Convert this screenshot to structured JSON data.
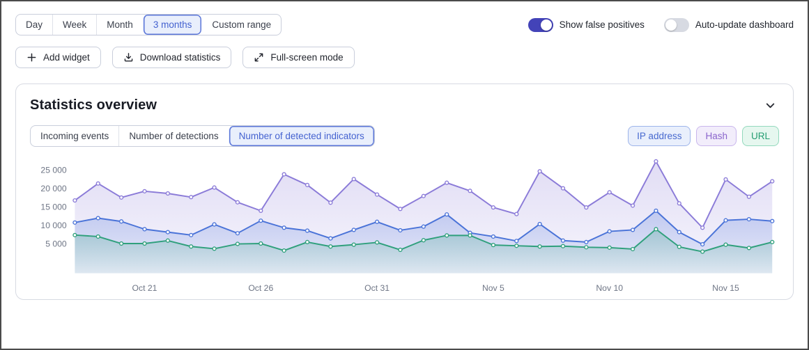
{
  "toolbar": {
    "range_tabs": [
      {
        "label": "Day",
        "active": false
      },
      {
        "label": "Week",
        "active": false
      },
      {
        "label": "Month",
        "active": false
      },
      {
        "label": "3 months",
        "active": true
      },
      {
        "label": "Custom range",
        "active": false
      }
    ],
    "toggles": [
      {
        "label": "Show false positives",
        "on": true
      },
      {
        "label": "Auto-update dashboard",
        "on": false
      }
    ],
    "toggle_on_color": "#4343b8",
    "toggle_off_color": "#d7dae2",
    "actions": [
      {
        "label": "Add widget",
        "icon": "plus-icon"
      },
      {
        "label": "Download statistics",
        "icon": "download-icon"
      },
      {
        "label": "Full-screen mode",
        "icon": "fullscreen-icon"
      }
    ]
  },
  "card": {
    "title": "Statistics overview",
    "accent_color": "#4462d0",
    "tabs": [
      {
        "label": "Incoming events",
        "active": false
      },
      {
        "label": "Number of detections",
        "active": false
      },
      {
        "label": "Number of detected indicators",
        "active": true
      }
    ],
    "badges": [
      {
        "label": "IP address",
        "text_color": "#4769cf",
        "bg": "#e9effc",
        "border": "#9db4ea"
      },
      {
        "label": "Hash",
        "text_color": "#8a64cc",
        "bg": "#f2edfb",
        "border": "#c9b6ec"
      },
      {
        "label": "URL",
        "text_color": "#259d72",
        "bg": "#e6f7ef",
        "border": "#93d9bd"
      }
    ]
  },
  "chart_data": {
    "type": "line",
    "title": "Statistics overview",
    "xlabel": "",
    "ylabel": "",
    "grid": false,
    "legend_position": "top-right chips",
    "legend": [
      "IP address",
      "Hash",
      "URL"
    ],
    "ylim": [
      0,
      28000
    ],
    "yticks": [
      5000,
      10000,
      15000,
      20000,
      25000
    ],
    "x": [
      "Oct 18",
      "Oct 19",
      "Oct 20",
      "Oct 21",
      "Oct 22",
      "Oct 23",
      "Oct 24",
      "Oct 25",
      "Oct 26",
      "Oct 27",
      "Oct 28",
      "Oct 29",
      "Oct 30",
      "Oct 31",
      "Nov 1",
      "Nov 2",
      "Nov 3",
      "Nov 4",
      "Nov 5",
      "Nov 6",
      "Nov 7",
      "Nov 8",
      "Nov 9",
      "Nov 10",
      "Nov 11",
      "Nov 12",
      "Nov 13",
      "Nov 14",
      "Nov 15",
      "Nov 16",
      "Nov 17"
    ],
    "xticks": [
      {
        "index": 3,
        "label": "Oct 21"
      },
      {
        "index": 8,
        "label": "Oct 26"
      },
      {
        "index": 13,
        "label": "Oct 31"
      },
      {
        "index": 18,
        "label": "Nov 5"
      },
      {
        "index": 23,
        "label": "Nov 10"
      },
      {
        "index": 28,
        "label": "Nov 15"
      }
    ],
    "series": [
      {
        "name": "Hash",
        "color": "#8b7bd8",
        "values": [
          16800,
          21400,
          17600,
          19300,
          18700,
          17700,
          20300,
          16300,
          14000,
          23900,
          21000,
          16200,
          22600,
          18400,
          14500,
          18000,
          21600,
          19400,
          14900,
          13100,
          24700,
          20100,
          14900,
          19000,
          15400,
          27400,
          16000,
          9400,
          22500,
          17800,
          22000
        ]
      },
      {
        "name": "IP address",
        "color": "#4a73d8",
        "values": [
          10800,
          12000,
          11100,
          9000,
          8200,
          7400,
          10300,
          7900,
          11300,
          9400,
          8600,
          6500,
          8800,
          11000,
          8700,
          9700,
          13000,
          8000,
          7000,
          5800,
          10400,
          5900,
          5500,
          8400,
          8800,
          14000,
          8200,
          4900,
          11400,
          11700,
          11200
        ]
      },
      {
        "name": "URL",
        "color": "#2fa07c",
        "values": [
          7400,
          7000,
          5100,
          5100,
          5900,
          4300,
          3700,
          5000,
          5100,
          3200,
          5500,
          4300,
          4800,
          5400,
          3400,
          6000,
          7300,
          7300,
          4700,
          4500,
          4300,
          4400,
          4100,
          4000,
          3600,
          9000,
          4200,
          2900,
          4800,
          3900,
          5500
        ]
      }
    ]
  }
}
